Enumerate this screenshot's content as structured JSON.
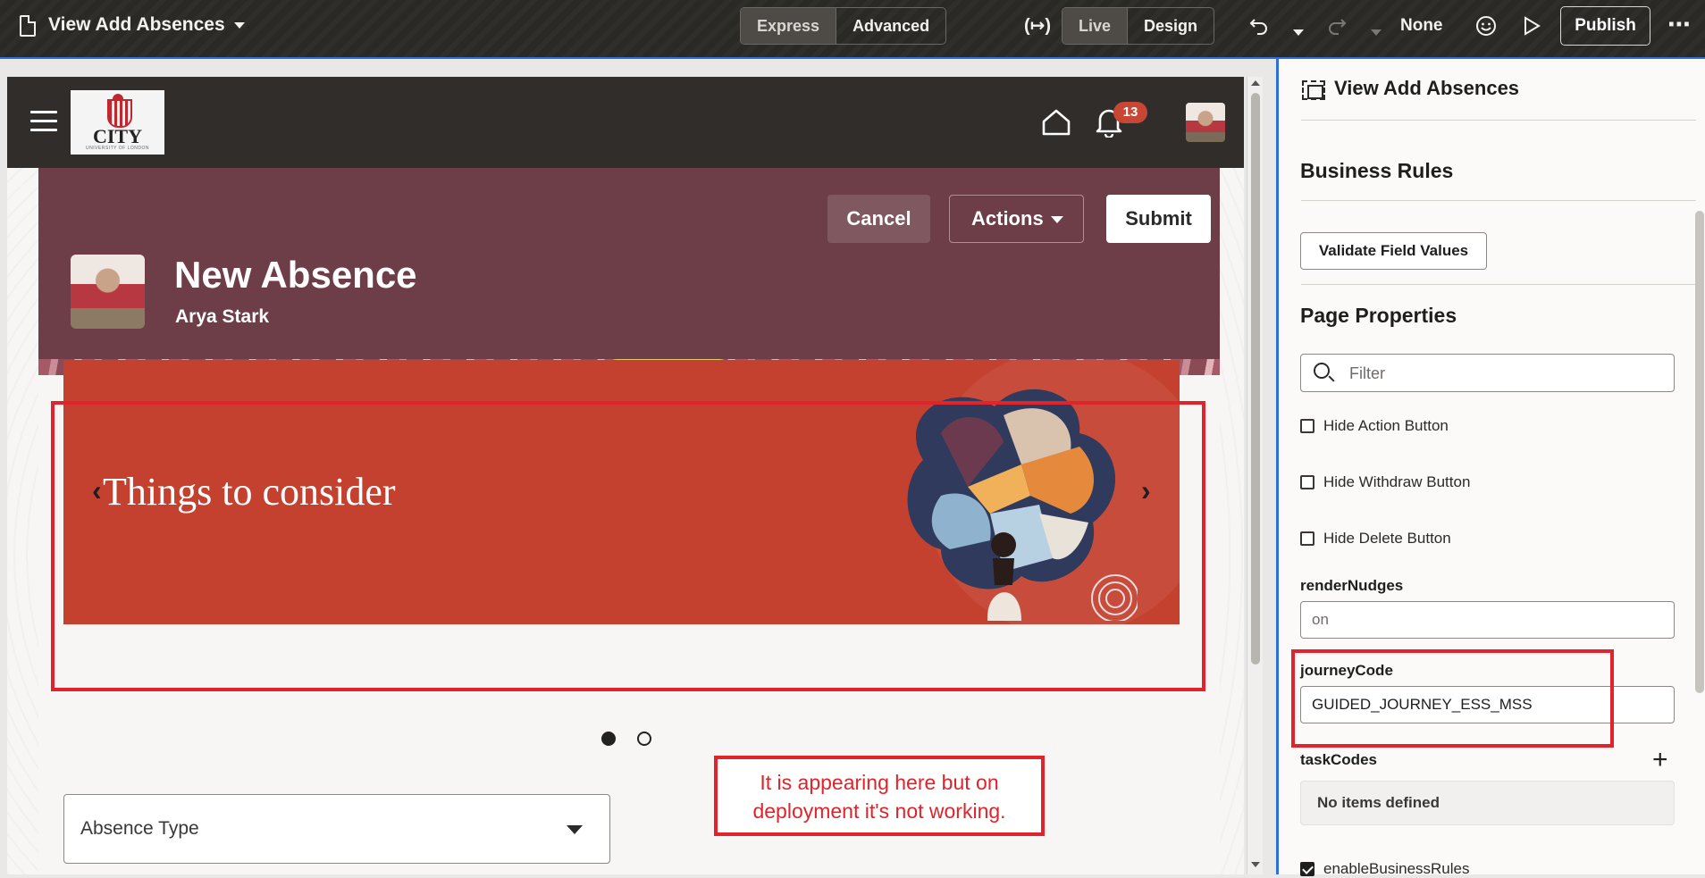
{
  "topbar": {
    "page_title": "View Add Absences",
    "modes": [
      "Express",
      "Advanced"
    ],
    "views": [
      "Live",
      "Design"
    ],
    "variable_icon_text": "(↦)",
    "scope": "None",
    "publish_label": "Publish"
  },
  "app": {
    "logo_text": "CITY",
    "logo_sub": "UNIVERSITY OF LONDON",
    "notifications_count": "13"
  },
  "hero": {
    "cancel_label": "Cancel",
    "actions_label": "Actions",
    "submit_label": "Submit",
    "title": "New Absence",
    "person_name": "Arya Stark"
  },
  "banner": {
    "text": "Things to consider",
    "prev": "‹",
    "next": "›",
    "slides": 2,
    "active_slide": 1
  },
  "form": {
    "absence_type_label": "Absence Type"
  },
  "annotation": {
    "note": "It is appearing here but on deployment it's not working."
  },
  "panel": {
    "title": "View Add Absences",
    "business_rules_heading": "Business Rules",
    "validate_button": "Validate Field Values",
    "page_properties_heading": "Page Properties",
    "filter_placeholder": "Filter",
    "checkboxes": [
      {
        "label": "Hide Action Button",
        "checked": false
      },
      {
        "label": "Hide Withdraw Button",
        "checked": false
      },
      {
        "label": "Hide Delete Button",
        "checked": false
      }
    ],
    "render_nudges_label": "renderNudges",
    "render_nudges_value": "on",
    "journey_code_label": "journeyCode",
    "journey_code_value": "GUIDED_JOURNEY_ESS_MSS",
    "task_codes_label": "taskCodes",
    "task_codes_empty": "No items defined",
    "enable_business_rules_label": "enableBusinessRules",
    "enable_business_rules_checked": true
  },
  "colors": {
    "topbar_bg": "#2b2926",
    "hero_bg": "#6e3e48",
    "banner_bg": "#c5412f",
    "annotation_red": "#e1232b",
    "accent_blue": "#2f6fd6"
  }
}
